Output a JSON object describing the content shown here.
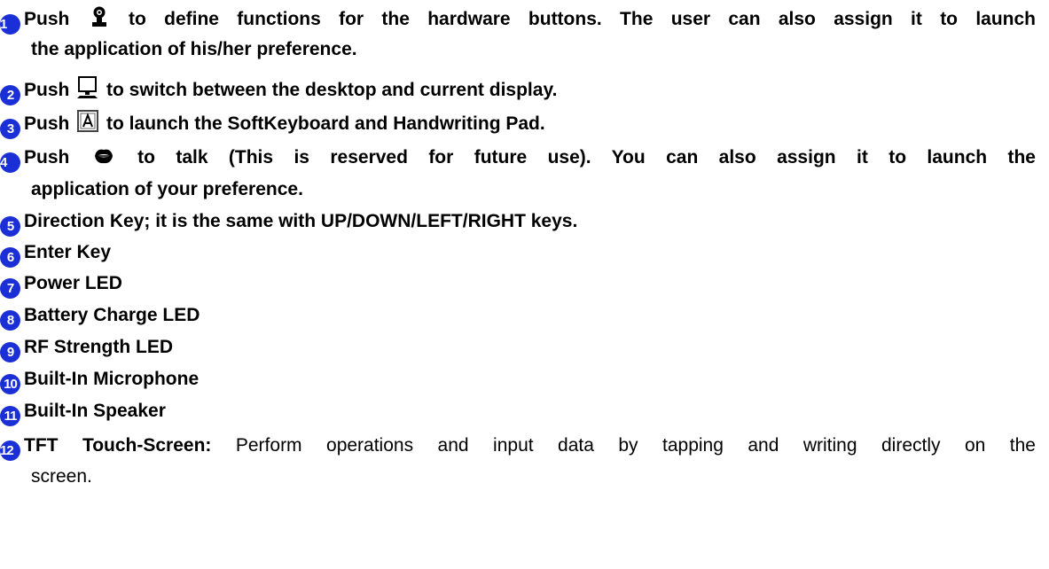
{
  "items": [
    {
      "num": "1",
      "prefix": "Push",
      "icon": "person-icon",
      "text1": "to define functions for the hardware buttons. The user can also assign it to launch",
      "text2": "the application of his/her preference."
    },
    {
      "num": "2",
      "prefix": "Push",
      "icon": "desktop-monitor-icon",
      "text1": "to switch between the desktop and current display."
    },
    {
      "num": "3",
      "prefix": "Push",
      "icon": "keyboard-a-icon",
      "text1": "to launch the SoftKeyboard and Handwriting Pad."
    },
    {
      "num": "4",
      "prefix": "Push",
      "icon": "talk-lips-icon",
      "text1": "to talk (This is reserved for future use). You can also assign it to launch the",
      "text2": "application of your preference."
    },
    {
      "num": "5",
      "text1": "Direction Key; it is the same with UP/DOWN/LEFT/RIGHT keys."
    },
    {
      "num": "6",
      "text1": "Enter Key"
    },
    {
      "num": "7",
      "text1": "Power LED"
    },
    {
      "num": "8",
      "text1": "Battery Charge LED"
    },
    {
      "num": "9",
      "text1": "RF Strength LED"
    },
    {
      "num": "10",
      "text1": "Built-In Microphone"
    },
    {
      "num": "11",
      "text1": "Built-In Speaker"
    },
    {
      "num": "12",
      "bold": "TFT Touch-Screen:",
      "text1": "Perform operations and input data by tapping and writing directly on the",
      "text2": "screen."
    }
  ],
  "colors": {
    "badge": "#1a2fd6",
    "text": "#000000"
  }
}
